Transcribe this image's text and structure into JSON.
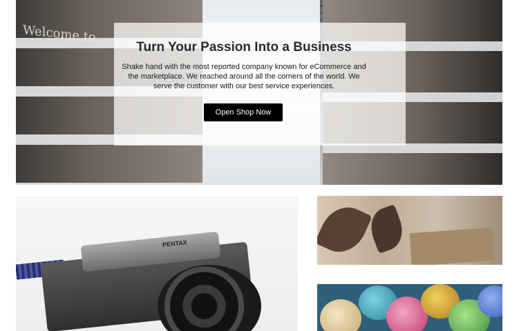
{
  "hero": {
    "title": "Turn Your Passion Into a Business",
    "description": "Shake hand with the most reported company known for eCommerce and the marketplace. We reached around all the corners of the world. We serve the customer with our best service experiences.",
    "button_label": "Open Shop Now",
    "sign_text": "Welcome to"
  },
  "tiles": [
    {
      "name": "camera",
      "camera_brand": "PENTAX"
    },
    {
      "name": "gift"
    },
    {
      "name": "eggs"
    }
  ],
  "colors": {
    "button_bg": "#000000",
    "button_text": "#ffffff",
    "title_text": "#2b2b2b",
    "overlay": "rgba(255,255,255,0.72)"
  }
}
